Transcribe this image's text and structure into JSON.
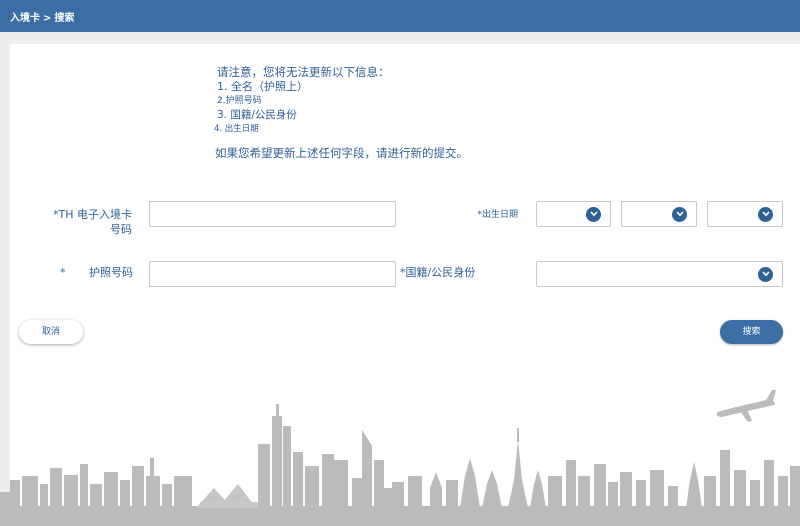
{
  "header": {
    "breadcrumb": [
      "入境卡",
      "搜索"
    ],
    "separator": ">"
  },
  "notice": {
    "title": "请注意，您将无法更新以下信息：",
    "items": [
      "1. 全名（护照上）",
      "2.护照号码",
      "3. 国籍/公民身份",
      "4. 出生日期"
    ],
    "footer": "如果您希望更新上述任何字段，请进行新的提交。"
  },
  "form": {
    "card_number_label": [
      "*TH 电子入境卡",
      "号码"
    ],
    "card_number_value": "",
    "dob_label": "*出生日期",
    "dob_day": "",
    "dob_month": "",
    "dob_year": "",
    "passport_label_star": "*",
    "passport_label": "护照号码",
    "passport_value": "",
    "nationality_label": "*国籍/公民身份",
    "nationality_value": ""
  },
  "buttons": {
    "cancel": "取消",
    "search": "搜索"
  },
  "icons": {
    "dropdown": "chevron-down-icon",
    "illustration": "city-skyline-with-airplane"
  },
  "colors": {
    "primary": "#3a6ea5",
    "text": "#2f6196",
    "skyline": "#b9b9b9"
  }
}
